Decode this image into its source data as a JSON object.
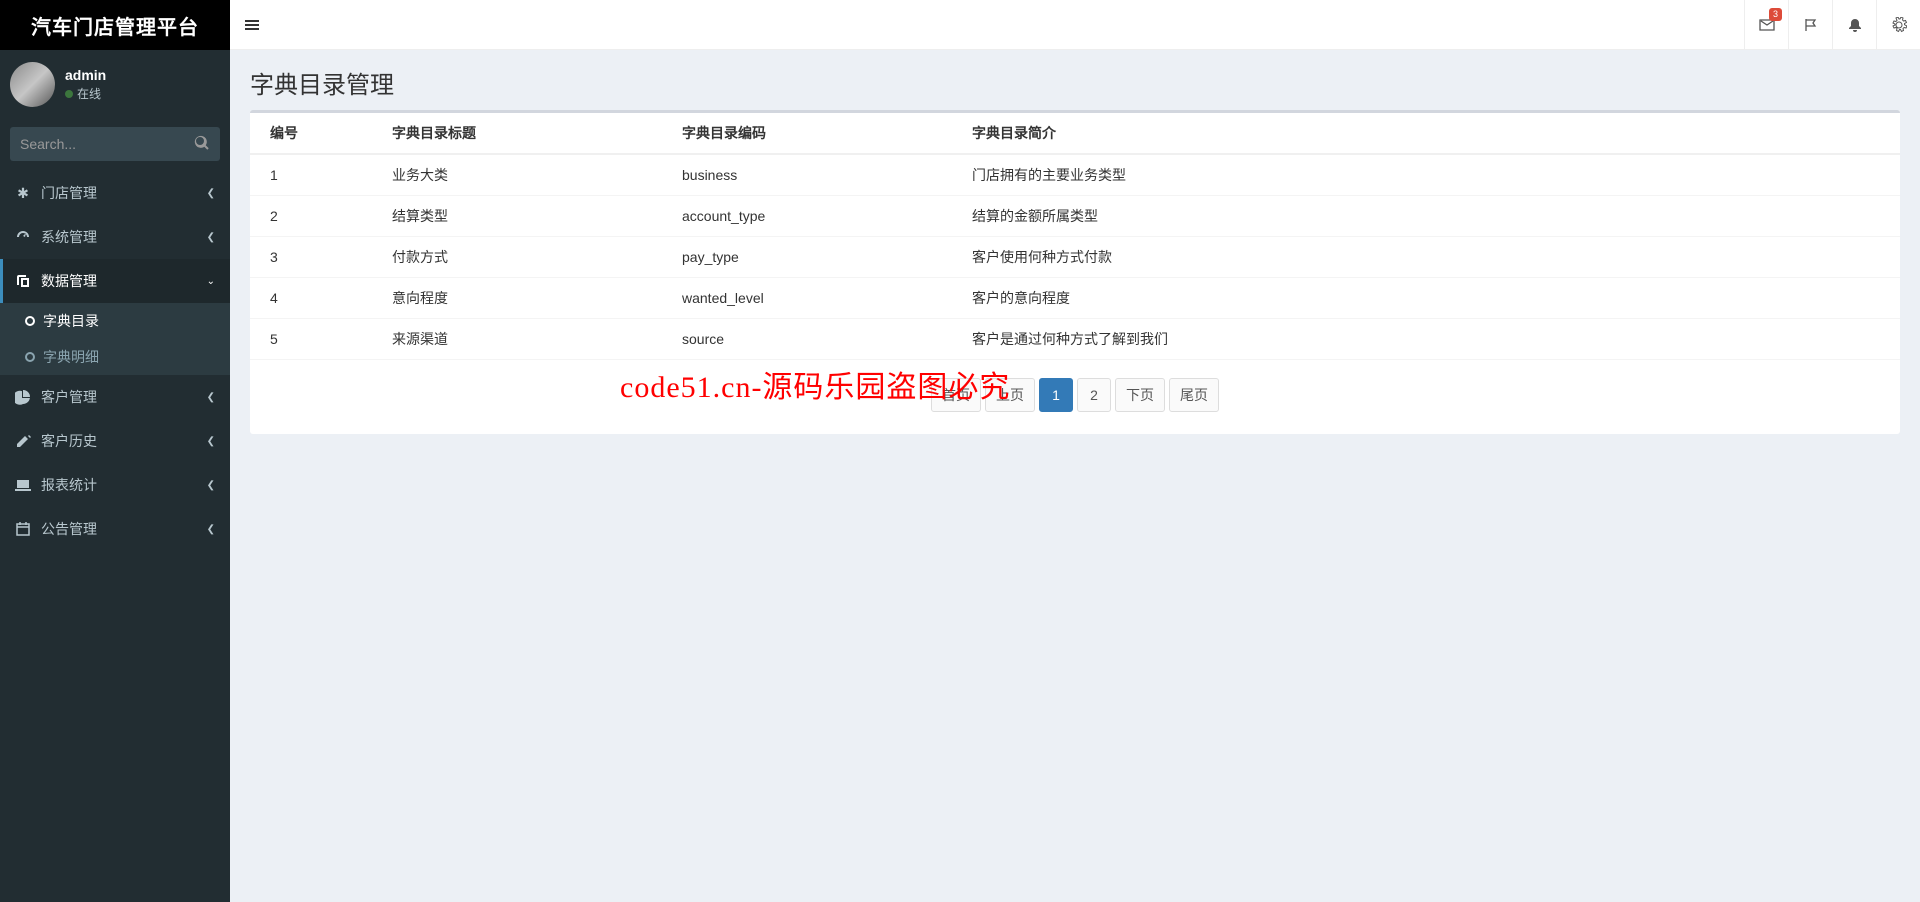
{
  "brand": "汽车门店管理平台",
  "user": {
    "name": "admin",
    "status": "在线"
  },
  "search": {
    "placeholder": "Search..."
  },
  "nav": {
    "store": "门店管理",
    "system": "系统管理",
    "data": "数据管理",
    "data_sub": {
      "dict_dir": "字典目录",
      "dict_detail": "字典明细"
    },
    "customer": "客户管理",
    "history": "客户历史",
    "report": "报表统计",
    "notice": "公告管理"
  },
  "topbar": {
    "mail_badge": "3"
  },
  "page": {
    "title": "字典目录管理"
  },
  "table": {
    "headers": {
      "id": "编号",
      "title": "字典目录标题",
      "code": "字典目录编码",
      "desc": "字典目录简介"
    },
    "rows": [
      {
        "id": "1",
        "title": "业务大类",
        "code": "business",
        "desc": "门店拥有的主要业务类型"
      },
      {
        "id": "2",
        "title": "结算类型",
        "code": "account_type",
        "desc": "结算的金额所属类型"
      },
      {
        "id": "3",
        "title": "付款方式",
        "code": "pay_type",
        "desc": "客户使用何种方式付款"
      },
      {
        "id": "4",
        "title": "意向程度",
        "code": "wanted_level",
        "desc": "客户的意向程度"
      },
      {
        "id": "5",
        "title": "来源渠道",
        "code": "source",
        "desc": "客户是通过何种方式了解到我们"
      }
    ]
  },
  "pagination": {
    "first": "首页",
    "prev": "上页",
    "p1": "1",
    "p2": "2",
    "next": "下页",
    "last": "尾页"
  },
  "watermark": "code51.cn-源码乐园盗图必究"
}
